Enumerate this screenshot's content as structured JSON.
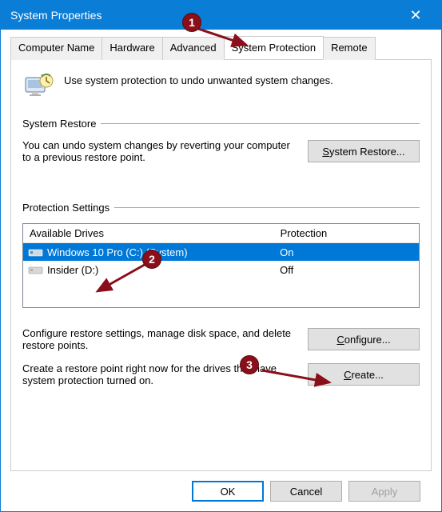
{
  "window": {
    "title": "System Properties"
  },
  "tabs": {
    "items": [
      {
        "label": "Computer Name",
        "active": false
      },
      {
        "label": "Hardware",
        "active": false
      },
      {
        "label": "Advanced",
        "active": false
      },
      {
        "label": "System Protection",
        "active": true
      },
      {
        "label": "Remote",
        "active": false
      }
    ]
  },
  "intro": {
    "text": "Use system protection to undo unwanted system changes."
  },
  "restore": {
    "group_title": "System Restore",
    "text": "You can undo system changes by reverting your computer to a previous restore point.",
    "button_prefix": "S",
    "button_rest": "ystem Restore..."
  },
  "protection": {
    "group_title": "Protection Settings",
    "header_drives": "Available Drives",
    "header_protection": "Protection",
    "drives": [
      {
        "name": "Windows 10 Pro (C:) (System)",
        "protection": "On",
        "selected": true
      },
      {
        "name": "Insider (D:)",
        "protection": "Off",
        "selected": false
      }
    ],
    "configure_text": "Configure restore settings, manage disk space, and delete restore points.",
    "configure_prefix": "C",
    "configure_rest": "onfigure...",
    "create_text": "Create a restore point right now for the drives that have system protection turned on.",
    "create_prefix": "C",
    "create_rest": "reate..."
  },
  "dialog": {
    "ok": "OK",
    "cancel": "Cancel",
    "apply": "Apply"
  },
  "annotations": {
    "b1": "1",
    "b2": "2",
    "b3": "3"
  }
}
